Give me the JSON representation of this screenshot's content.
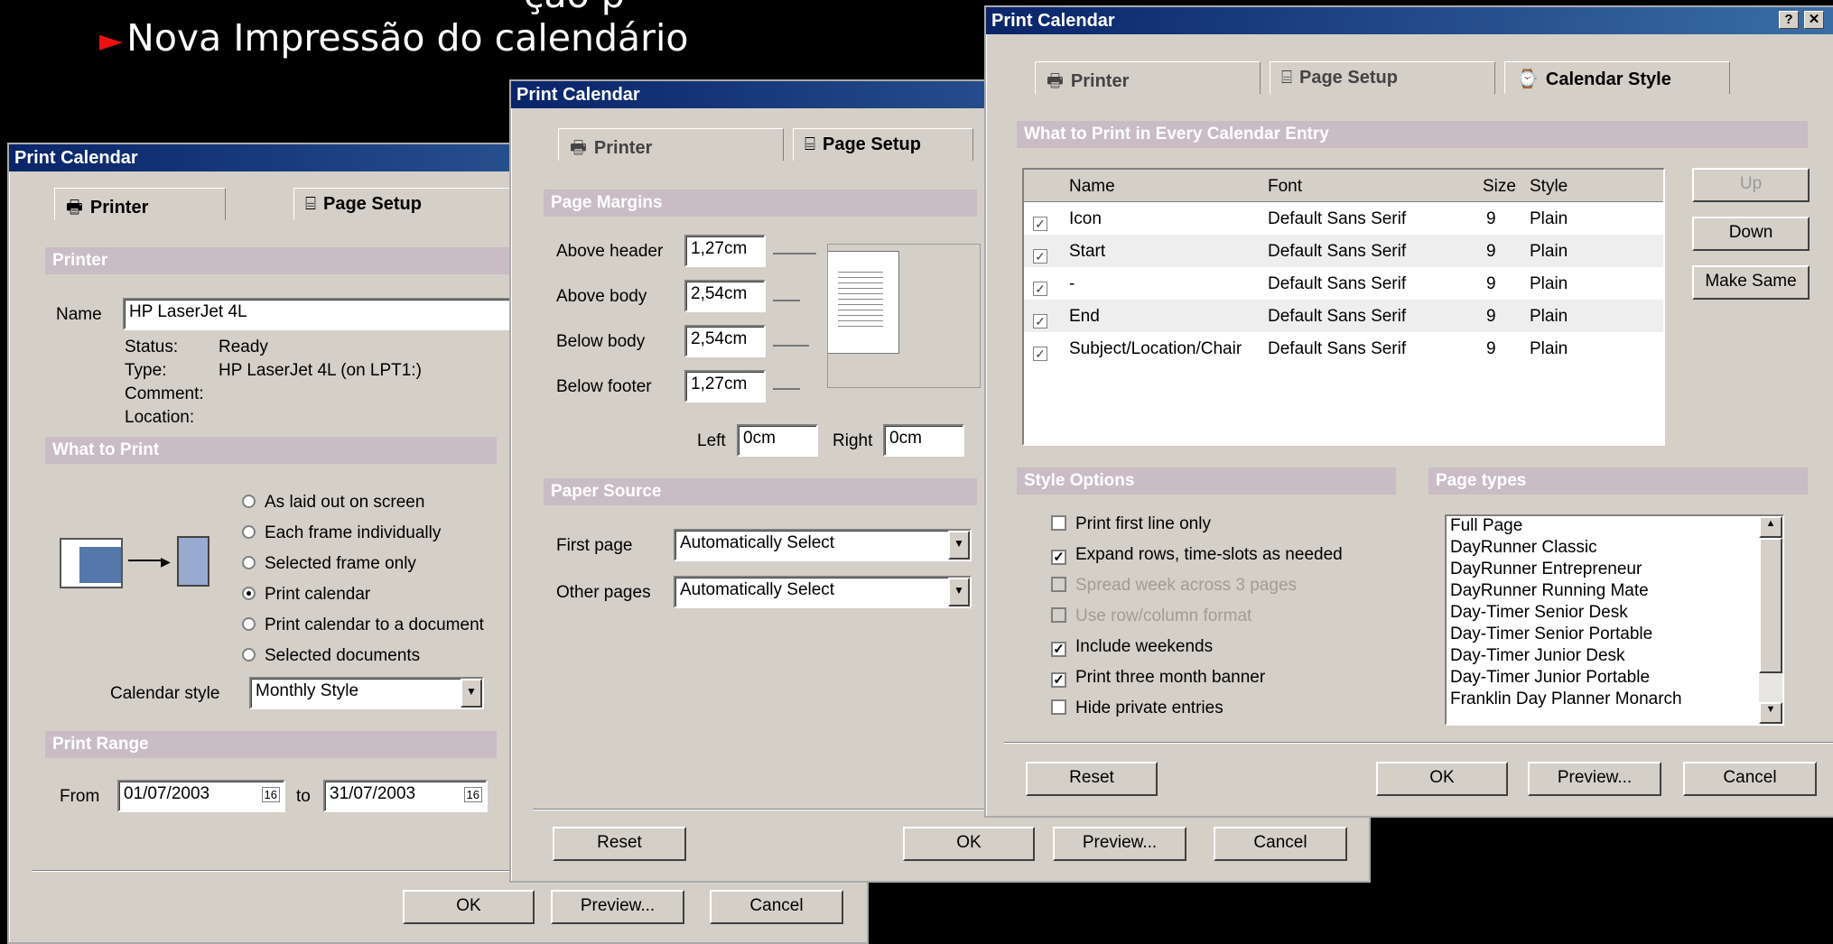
{
  "slide": {
    "bullet": "Nova Impressão do calendário",
    "partial_title": "ção    p"
  },
  "dialog_title": "Print Calendar",
  "tabs": {
    "printer": "Printer",
    "page_setup": "Page Setup",
    "calendar_style": "Calendar Style"
  },
  "d1": {
    "section_printer": "Printer",
    "name_label": "Name",
    "name_value": "HP LaserJet 4L",
    "status_label": "Status:",
    "status_value": "Ready",
    "type_label": "Type:",
    "type_value": "HP LaserJet 4L (on LPT1:)",
    "comment_label": "Comment:",
    "location_label": "Location:",
    "section_what": "What to Print",
    "radios": [
      "As laid out on screen",
      "Each frame individually",
      "Selected frame only",
      "Print calendar",
      "Print calendar to a document",
      "Selected documents"
    ],
    "calendar_style_label": "Calendar style",
    "calendar_style_value": "Monthly Style",
    "section_range": "Print Range",
    "from_label": "From",
    "from_value": "01/07/2003",
    "to_label": "to",
    "to_value": "31/07/2003",
    "cal_icon": "16",
    "ok": "OK",
    "preview": "Preview...",
    "cancel": "Cancel"
  },
  "d2": {
    "section_margins": "Page Margins",
    "above_header_label": "Above header",
    "above_header": "1,27cm",
    "above_body_label": "Above body",
    "above_body": "2,54cm",
    "below_body_label": "Below body",
    "below_body": "2,54cm",
    "below_footer_label": "Below footer",
    "below_footer": "1,27cm",
    "left_label": "Left",
    "left": "0cm",
    "right_label": "Right",
    "right": "0cm",
    "section_paper": "Paper Source",
    "first_page_label": "First page",
    "first_page": "Automatically Select",
    "other_pages_label": "Other pages",
    "other_pages": "Automatically Select",
    "reset": "Reset",
    "ok": "OK",
    "preview": "Preview...",
    "cancel": "Cancel"
  },
  "d3": {
    "section_entry": "What to Print in Every Calendar Entry",
    "columns": {
      "name": "Name",
      "font": "Font",
      "size": "Size",
      "style": "Style"
    },
    "rows": [
      {
        "name": "Icon",
        "font": "Default Sans Serif",
        "size": "9",
        "style": "Plain"
      },
      {
        "name": "Start",
        "font": "Default Sans Serif",
        "size": "9",
        "style": "Plain"
      },
      {
        "name": "-",
        "font": "Default Sans Serif",
        "size": "9",
        "style": "Plain"
      },
      {
        "name": "End",
        "font": "Default Sans Serif",
        "size": "9",
        "style": "Plain"
      },
      {
        "name": "Subject/Location/Chair",
        "font": "Default Sans Serif",
        "size": "9",
        "style": "Plain"
      }
    ],
    "up": "Up",
    "down": "Down",
    "make_same": "Make Same",
    "section_style": "Style Options",
    "options": [
      "Print first line only",
      "Expand rows, time-slots as needed",
      "Spread week across 3 pages",
      "Use row/column format",
      "Include weekends",
      "Print three month banner",
      "Hide private entries"
    ],
    "section_types": "Page types",
    "page_types": [
      "Full Page",
      "DayRunner Classic",
      "DayRunner Entrepreneur",
      "DayRunner Running Mate",
      "Day-Timer Senior Desk",
      "Day-Timer Senior Portable",
      "Day-Timer Junior Desk",
      "Day-Timer Junior Portable",
      "Franklin Day Planner Monarch"
    ],
    "reset": "Reset",
    "ok": "OK",
    "preview": "Preview...",
    "cancel": "Cancel"
  }
}
